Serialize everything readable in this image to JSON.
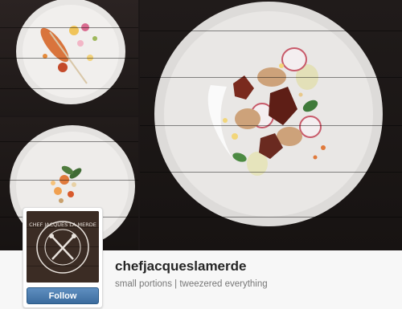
{
  "profile": {
    "username": "chefjacqueslamerde",
    "bio": "small portions | tweezered everything",
    "follow_label": "Follow",
    "avatar_text": "CHEF JACQUES LA MERDE"
  },
  "photos": [
    {
      "name": "plate-with-sausage"
    },
    {
      "name": "plate-with-garnish"
    },
    {
      "name": "plate-with-tuiles"
    }
  ],
  "colors": {
    "follow_button": "#3c6c9e",
    "background_dark": "#1c1717"
  }
}
